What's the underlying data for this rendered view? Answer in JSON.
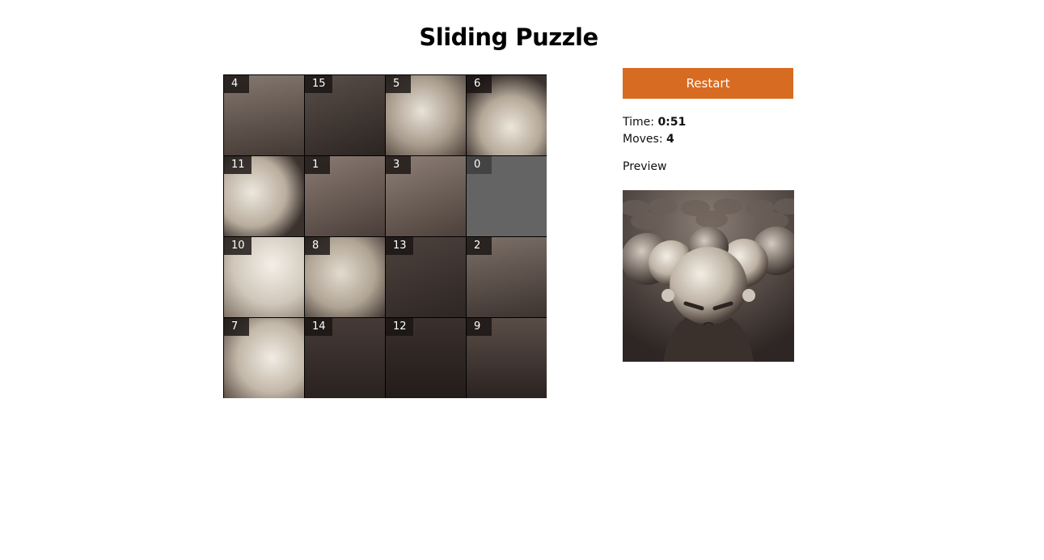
{
  "title": "Sliding Puzzle",
  "restart_label": "Restart",
  "stats": {
    "time_label": "Time:",
    "time_value": "0:51",
    "moves_label": "Moves:",
    "moves_value": "4"
  },
  "preview_label": "Preview",
  "board": {
    "tiles": [
      [
        "4",
        "15",
        "5",
        "6"
      ],
      [
        "11",
        "1",
        "3",
        "0"
      ],
      [
        "10",
        "8",
        "13",
        "2"
      ],
      [
        "7",
        "14",
        "12",
        "9"
      ]
    ],
    "empty_tile": "0"
  },
  "colors": {
    "accent": "#d76b21",
    "empty_tile": "#646464",
    "label_bg": "#1e1a18"
  }
}
